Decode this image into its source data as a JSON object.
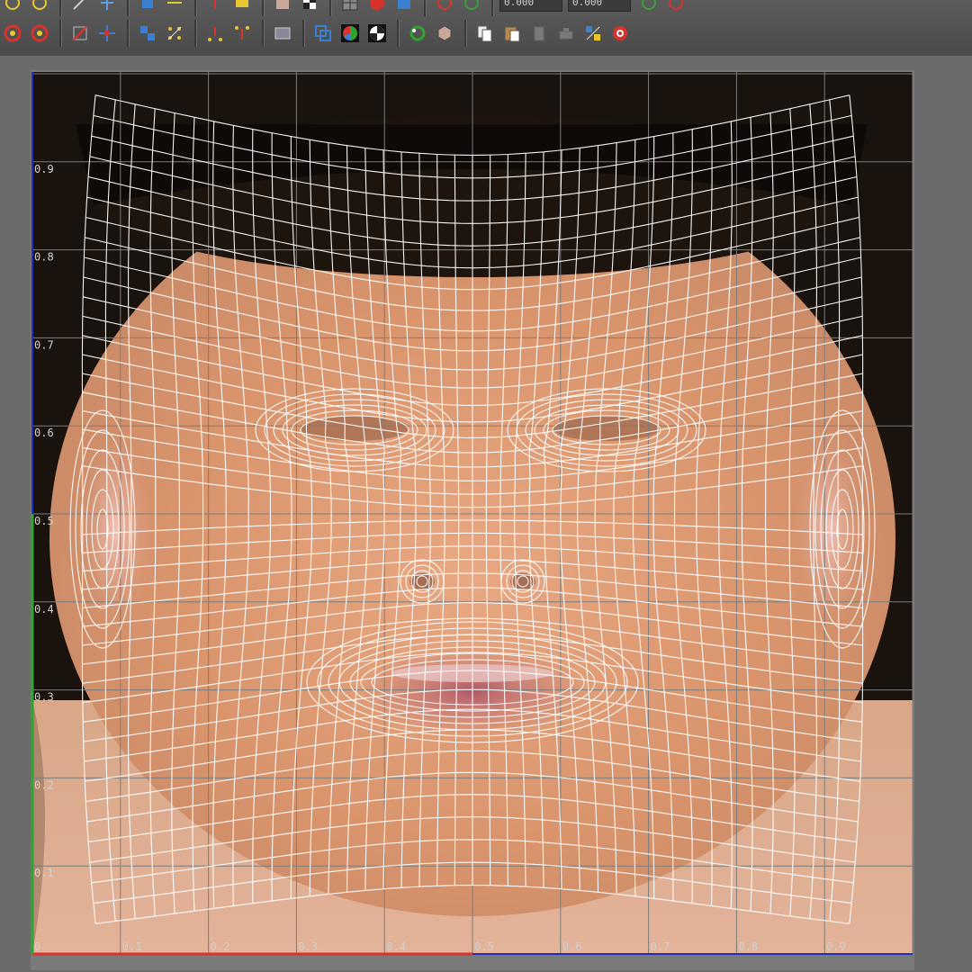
{
  "toolbar": {
    "field_1": "0.000",
    "field_2": "0.000",
    "row1_icons": [
      "rotate-ccw-icon",
      "rotate-cw-icon",
      "scale-icon",
      "flip-icon",
      "move-icon",
      "snap-icon",
      "cut-icon",
      "select-icon",
      "checker-icon",
      "grid-icon",
      "rgb-icon",
      "alpha-icon",
      "swap-icon",
      "checker-pattern-icon"
    ],
    "row2_icons": [
      "rotate-ccw-red-icon",
      "rotate-cw-red-icon",
      "scale-uv-icon",
      "move-uv-icon",
      "align-uv-icon",
      "distribute-uv-icon",
      "pin-icon",
      "stack-icon",
      "image-icon",
      "isolate-icon",
      "texture-rgb-icon",
      "texture-alpha-icon",
      "recycle-icon",
      "checker-map-icon",
      "copy-icon",
      "paste-icon",
      "paste-disabled-icon",
      "delete-disabled-icon",
      "grid-snap-icon",
      "target-icon"
    ]
  },
  "uv_editor": {
    "axis_labels_u": [
      "0",
      "0.1",
      "0.2",
      "0.3",
      "0.4",
      "0.5",
      "0.6",
      "0.7",
      "0.8",
      "0.9"
    ],
    "axis_labels_v": [
      "0.1",
      "0.2",
      "0.3",
      "0.4",
      "0.5",
      "0.6",
      "0.7",
      "0.8",
      "0.9"
    ],
    "colors": {
      "grid": "#7c7c7c",
      "uv_wire": "#ffffff",
      "u_axis": "#d9312b",
      "v_axis": "#2fa42f",
      "border_axis": "#1f2fbf"
    }
  }
}
